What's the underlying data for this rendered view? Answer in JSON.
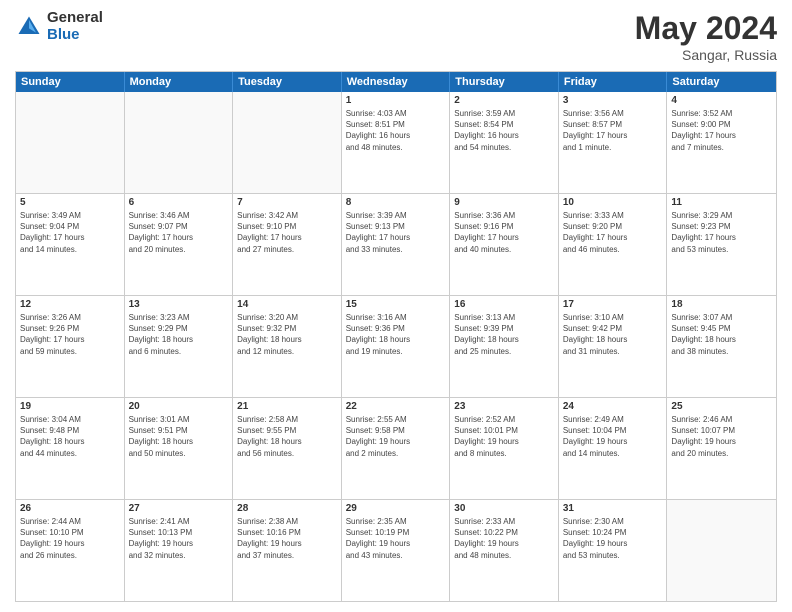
{
  "header": {
    "logo_general": "General",
    "logo_blue": "Blue",
    "month_year": "May 2024",
    "location": "Sangar, Russia"
  },
  "weekdays": [
    "Sunday",
    "Monday",
    "Tuesday",
    "Wednesday",
    "Thursday",
    "Friday",
    "Saturday"
  ],
  "rows": [
    [
      {
        "day": "",
        "info": ""
      },
      {
        "day": "",
        "info": ""
      },
      {
        "day": "",
        "info": ""
      },
      {
        "day": "1",
        "info": "Sunrise: 4:03 AM\nSunset: 8:51 PM\nDaylight: 16 hours\nand 48 minutes."
      },
      {
        "day": "2",
        "info": "Sunrise: 3:59 AM\nSunset: 8:54 PM\nDaylight: 16 hours\nand 54 minutes."
      },
      {
        "day": "3",
        "info": "Sunrise: 3:56 AM\nSunset: 8:57 PM\nDaylight: 17 hours\nand 1 minute."
      },
      {
        "day": "4",
        "info": "Sunrise: 3:52 AM\nSunset: 9:00 PM\nDaylight: 17 hours\nand 7 minutes."
      }
    ],
    [
      {
        "day": "5",
        "info": "Sunrise: 3:49 AM\nSunset: 9:04 PM\nDaylight: 17 hours\nand 14 minutes."
      },
      {
        "day": "6",
        "info": "Sunrise: 3:46 AM\nSunset: 9:07 PM\nDaylight: 17 hours\nand 20 minutes."
      },
      {
        "day": "7",
        "info": "Sunrise: 3:42 AM\nSunset: 9:10 PM\nDaylight: 17 hours\nand 27 minutes."
      },
      {
        "day": "8",
        "info": "Sunrise: 3:39 AM\nSunset: 9:13 PM\nDaylight: 17 hours\nand 33 minutes."
      },
      {
        "day": "9",
        "info": "Sunrise: 3:36 AM\nSunset: 9:16 PM\nDaylight: 17 hours\nand 40 minutes."
      },
      {
        "day": "10",
        "info": "Sunrise: 3:33 AM\nSunset: 9:20 PM\nDaylight: 17 hours\nand 46 minutes."
      },
      {
        "day": "11",
        "info": "Sunrise: 3:29 AM\nSunset: 9:23 PM\nDaylight: 17 hours\nand 53 minutes."
      }
    ],
    [
      {
        "day": "12",
        "info": "Sunrise: 3:26 AM\nSunset: 9:26 PM\nDaylight: 17 hours\nand 59 minutes."
      },
      {
        "day": "13",
        "info": "Sunrise: 3:23 AM\nSunset: 9:29 PM\nDaylight: 18 hours\nand 6 minutes."
      },
      {
        "day": "14",
        "info": "Sunrise: 3:20 AM\nSunset: 9:32 PM\nDaylight: 18 hours\nand 12 minutes."
      },
      {
        "day": "15",
        "info": "Sunrise: 3:16 AM\nSunset: 9:36 PM\nDaylight: 18 hours\nand 19 minutes."
      },
      {
        "day": "16",
        "info": "Sunrise: 3:13 AM\nSunset: 9:39 PM\nDaylight: 18 hours\nand 25 minutes."
      },
      {
        "day": "17",
        "info": "Sunrise: 3:10 AM\nSunset: 9:42 PM\nDaylight: 18 hours\nand 31 minutes."
      },
      {
        "day": "18",
        "info": "Sunrise: 3:07 AM\nSunset: 9:45 PM\nDaylight: 18 hours\nand 38 minutes."
      }
    ],
    [
      {
        "day": "19",
        "info": "Sunrise: 3:04 AM\nSunset: 9:48 PM\nDaylight: 18 hours\nand 44 minutes."
      },
      {
        "day": "20",
        "info": "Sunrise: 3:01 AM\nSunset: 9:51 PM\nDaylight: 18 hours\nand 50 minutes."
      },
      {
        "day": "21",
        "info": "Sunrise: 2:58 AM\nSunset: 9:55 PM\nDaylight: 18 hours\nand 56 minutes."
      },
      {
        "day": "22",
        "info": "Sunrise: 2:55 AM\nSunset: 9:58 PM\nDaylight: 19 hours\nand 2 minutes."
      },
      {
        "day": "23",
        "info": "Sunrise: 2:52 AM\nSunset: 10:01 PM\nDaylight: 19 hours\nand 8 minutes."
      },
      {
        "day": "24",
        "info": "Sunrise: 2:49 AM\nSunset: 10:04 PM\nDaylight: 19 hours\nand 14 minutes."
      },
      {
        "day": "25",
        "info": "Sunrise: 2:46 AM\nSunset: 10:07 PM\nDaylight: 19 hours\nand 20 minutes."
      }
    ],
    [
      {
        "day": "26",
        "info": "Sunrise: 2:44 AM\nSunset: 10:10 PM\nDaylight: 19 hours\nand 26 minutes."
      },
      {
        "day": "27",
        "info": "Sunrise: 2:41 AM\nSunset: 10:13 PM\nDaylight: 19 hours\nand 32 minutes."
      },
      {
        "day": "28",
        "info": "Sunrise: 2:38 AM\nSunset: 10:16 PM\nDaylight: 19 hours\nand 37 minutes."
      },
      {
        "day": "29",
        "info": "Sunrise: 2:35 AM\nSunset: 10:19 PM\nDaylight: 19 hours\nand 43 minutes."
      },
      {
        "day": "30",
        "info": "Sunrise: 2:33 AM\nSunset: 10:22 PM\nDaylight: 19 hours\nand 48 minutes."
      },
      {
        "day": "31",
        "info": "Sunrise: 2:30 AM\nSunset: 10:24 PM\nDaylight: 19 hours\nand 53 minutes."
      },
      {
        "day": "",
        "info": ""
      }
    ]
  ]
}
